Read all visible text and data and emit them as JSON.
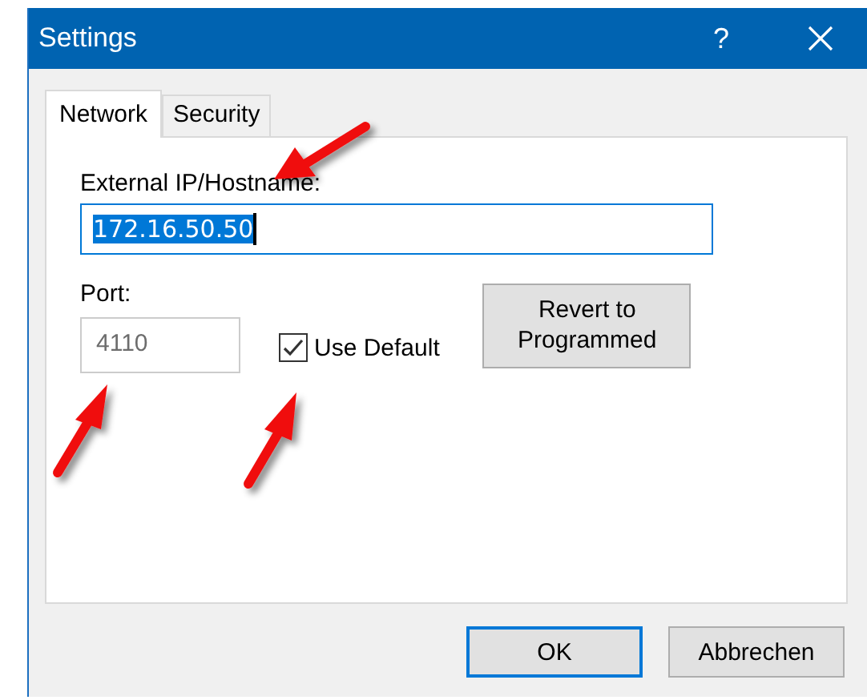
{
  "window": {
    "title": "Settings",
    "help": "?"
  },
  "tabs": [
    {
      "label": "Network",
      "selected": true
    },
    {
      "label": "Security",
      "selected": false
    }
  ],
  "host": {
    "label": "External IP/Hostname:",
    "value": "172.16.50.50",
    "text_selected": true
  },
  "port": {
    "label": "Port:",
    "value": "4110",
    "disabled": true
  },
  "use_default": {
    "label": "Use Default",
    "checked": true
  },
  "revert_button": "Revert to Programmed",
  "buttons": [
    {
      "label": "OK",
      "default": true
    },
    {
      "label": "Abbrechen",
      "default": false
    }
  ]
}
